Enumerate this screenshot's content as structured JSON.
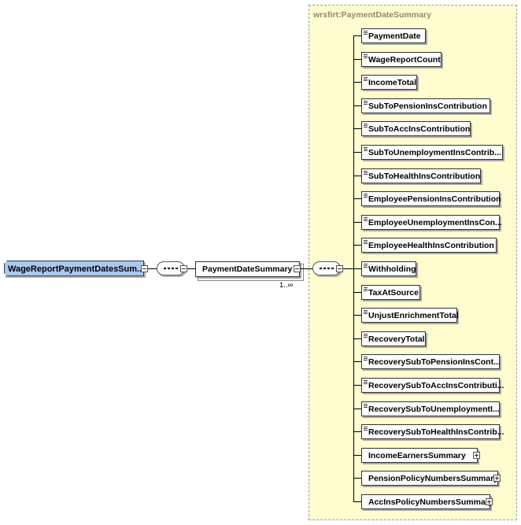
{
  "root": {
    "label": "WageReportPaymentDatesSum..."
  },
  "sequence_icon": "sequence-compositor-icon",
  "payment_date_summary": {
    "label": "PaymentDateSummary",
    "cardinality": "1..∞"
  },
  "group": {
    "title": "wrsfirt:PaymentDateSummary"
  },
  "children": [
    {
      "label": "PaymentDate",
      "type": "element"
    },
    {
      "label": "WageReportCount",
      "type": "element"
    },
    {
      "label": "IncomeTotal",
      "type": "element"
    },
    {
      "label": "SubToPensionInsContribution",
      "type": "element"
    },
    {
      "label": "SubToAccInsContribution",
      "type": "element"
    },
    {
      "label": "SubToUnemploymentInsContrib...",
      "type": "element"
    },
    {
      "label": "SubToHealthInsContribution",
      "type": "element"
    },
    {
      "label": "EmployeePensionInsContribution",
      "type": "element"
    },
    {
      "label": "EmployeeUnemploymentInsCon...",
      "type": "element"
    },
    {
      "label": "EmployeeHealthInsContribution",
      "type": "element"
    },
    {
      "label": "Withholding",
      "type": "element"
    },
    {
      "label": "TaxAtSource",
      "type": "element"
    },
    {
      "label": "UnjustEnrichmentTotal",
      "type": "element"
    },
    {
      "label": "RecoveryTotal",
      "type": "element"
    },
    {
      "label": "RecoverySubToPensionInsCont...",
      "type": "element"
    },
    {
      "label": "RecoverySubToAccInsContributi...",
      "type": "element"
    },
    {
      "label": "RecoverySubToUnemploymentI...",
      "type": "element"
    },
    {
      "label": "RecoverySubToHealthInsContrib...",
      "type": "element"
    },
    {
      "label": "IncomeEarnersSummary",
      "type": "complex"
    },
    {
      "label": "PensionPolicyNumbersSummary",
      "type": "complex"
    },
    {
      "label": "AccInsPolicyNumbersSummary",
      "type": "complex"
    }
  ]
}
